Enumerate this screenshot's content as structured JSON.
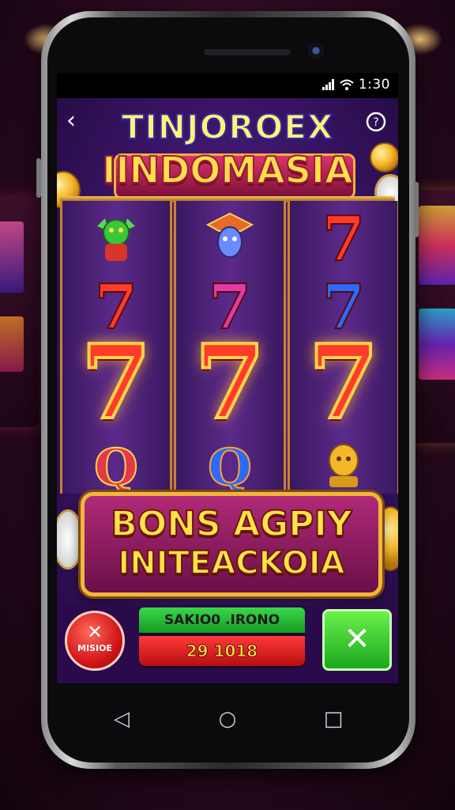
{
  "status_bar": {
    "time": "1:30",
    "signal_icon": "signal-icon",
    "wifi_icon": "wifi-icon"
  },
  "game": {
    "title_line1": "TINJOROEX",
    "title_line2": "IINDOMASIA",
    "reels": [
      [
        "goblin",
        "7",
        "7",
        "Q"
      ],
      [
        "jester",
        "7",
        "7",
        "Q"
      ],
      [
        "7",
        "7",
        "7",
        "idol"
      ]
    ],
    "bonus_line1": "BONS AGPIY",
    "bonus_line2": "INITEACKOIA",
    "stop_button_label": "MISIOE",
    "info_label": "SAKIO0 .IRONO",
    "info_value": "29 1018",
    "colors": {
      "seven_red": "#ff3b2a",
      "seven_pink": "#e23aa8",
      "seven_blue": "#2a6aff",
      "accent_gold": "#ffe04a"
    }
  },
  "nav": {
    "back": "◁",
    "home": "○",
    "recents": "□"
  }
}
